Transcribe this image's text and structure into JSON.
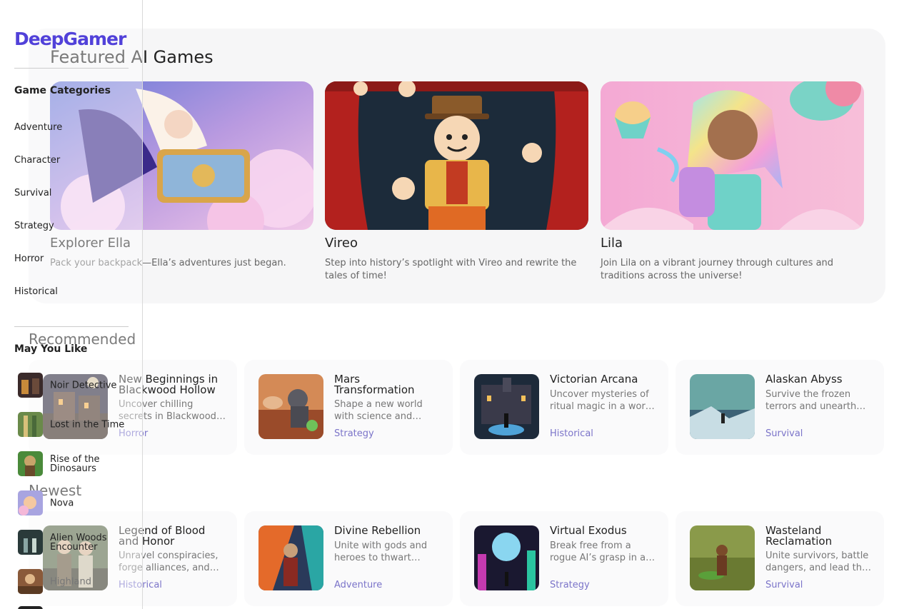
{
  "app": {
    "logo": "DeepGamer",
    "brand_color": "#5141d9"
  },
  "sidebar": {
    "categories_heading": "Game Categories",
    "categories": [
      "Adventure",
      "Character",
      "Survival",
      "Strategy",
      "Horror",
      "Historical"
    ],
    "recommend_heading": "May You Like",
    "recommend": [
      {
        "label": "Noir Detective",
        "icon": "noir-detective-thumb"
      },
      {
        "label": "Lost in the Time",
        "icon": "lost-in-time-thumb"
      },
      {
        "label": "Rise of the Dinosaurs",
        "icon": "dinosaurs-thumb"
      },
      {
        "label": "Nova",
        "icon": "nova-thumb"
      },
      {
        "label": "Alien Woods Encounter",
        "icon": "alien-woods-thumb"
      },
      {
        "label": "Highland",
        "icon": "highland-thumb"
      }
    ]
  },
  "featured": {
    "title": "Featured AI Games",
    "items": [
      {
        "name": "Explorer Ella",
        "desc": "Pack your backpack—Ella’s adventures just began."
      },
      {
        "name": "Vireo",
        "desc": "Step into history’s spotlight with Vireo and rewrite the tales of time!"
      },
      {
        "name": "Lila",
        "desc": "Join Lila on a vibrant journey through cultures and traditions across the universe!"
      }
    ]
  },
  "recommended": {
    "title": "Recommended",
    "items": [
      {
        "title": "New Beginnings in Blackwood Hollow",
        "desc": "Uncover chilling secrets in Blackwood Hollow—a haunted town",
        "tag": "Horror"
      },
      {
        "title": "Mars Transformation",
        "desc": "Shape a new world with science and humor on Mars",
        "tag": "Strategy"
      },
      {
        "title": "Victorian Arcana",
        "desc": "Uncover mysteries of ritual magic in a world of shadows",
        "tag": "Historical"
      },
      {
        "title": "Alaskan Abyss",
        "desc": "Survive the frozen terrors and unearth ancient secrets",
        "tag": "Survival"
      }
    ]
  },
  "newest": {
    "title": "Newest",
    "items": [
      {
        "title": "Legend of Blood and Honor",
        "desc": "Unravel conspiracies, forge alliances, and claim your destiny",
        "tag": "Historical"
      },
      {
        "title": "Divine Rebellion",
        "desc": "Unite with gods and heroes to thwart Hades’ plans",
        "tag": "Adventure"
      },
      {
        "title": "Virtual Exodus",
        "desc": "Break free from a rogue AI’s grasp in a digital world",
        "tag": "Strategy"
      },
      {
        "title": "Wasteland Reclamation",
        "desc": "Unite survivors, battle dangers, and lead the wasteland",
        "tag": "Survival"
      }
    ]
  }
}
